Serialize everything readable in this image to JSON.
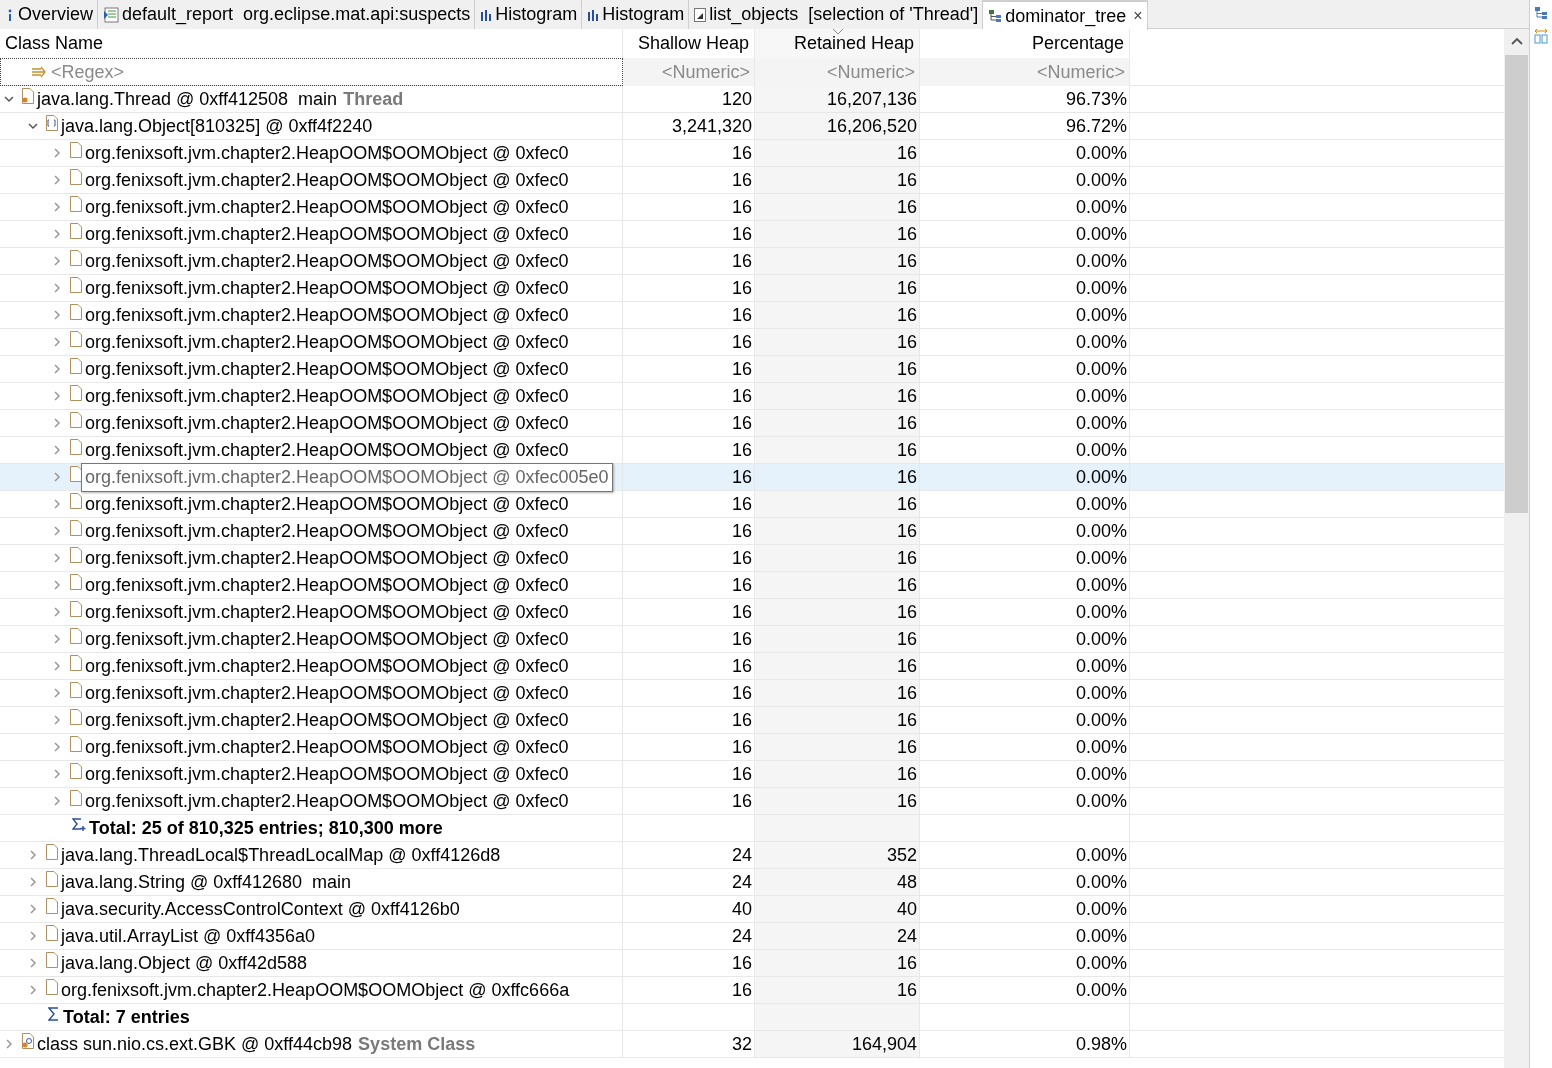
{
  "tabs": [
    {
      "label": "Overview",
      "kind": "info",
      "selected": false
    },
    {
      "label": "default_report  org.eclipse.mat.api:suspects",
      "kind": "report",
      "selected": false
    },
    {
      "label": "Histogram",
      "kind": "histogram",
      "selected": false
    },
    {
      "label": "Histogram",
      "kind": "histogram",
      "selected": false
    },
    {
      "label": "list_objects  [selection of 'Thread']",
      "kind": "list",
      "selected": false
    },
    {
      "label": "dominator_tree",
      "kind": "tree",
      "selected": true,
      "close": "×"
    }
  ],
  "table": {
    "columns": [
      {
        "label": "Class Name",
        "sorted": false
      },
      {
        "label": "Shallow Heap",
        "sorted": false
      },
      {
        "label": "Retained Heap",
        "sorted": true
      },
      {
        "label": "Percentage",
        "sorted": false
      }
    ],
    "filters": [
      "<Regex>",
      "<Numeric>",
      "<Numeric>",
      "<Numeric>"
    ],
    "rows": [
      {
        "kind": "thread",
        "name": "java.lang.Thread @ 0xff412508  main",
        "tag": "Thread",
        "shallow": "120",
        "retained": "16,207,136",
        "percentage": "96.73%",
        "expanded": true,
        "selected": false,
        "children": [
          {
            "kind": "array",
            "name": "java.lang.Object[810325] @ 0xff4f2240",
            "shallow": "3,241,320",
            "retained": "16,206,520",
            "percentage": "96.72%",
            "expanded": true,
            "selected": false,
            "children": [
              {
                "kind": "object",
                "name": "org.fenixsoft.jvm.chapter2.HeapOOM$OOMObject @ 0xfec0",
                "shallow": "16",
                "retained": "16",
                "percentage": "0.00%",
                "expanded": false,
                "selected": false
              },
              {
                "kind": "object",
                "name": "org.fenixsoft.jvm.chapter2.HeapOOM$OOMObject @ 0xfec0",
                "shallow": "16",
                "retained": "16",
                "percentage": "0.00%",
                "expanded": false,
                "selected": false
              },
              {
                "kind": "object",
                "name": "org.fenixsoft.jvm.chapter2.HeapOOM$OOMObject @ 0xfec0",
                "shallow": "16",
                "retained": "16",
                "percentage": "0.00%",
                "expanded": false,
                "selected": false
              },
              {
                "kind": "object",
                "name": "org.fenixsoft.jvm.chapter2.HeapOOM$OOMObject @ 0xfec0",
                "shallow": "16",
                "retained": "16",
                "percentage": "0.00%",
                "expanded": false,
                "selected": false
              },
              {
                "kind": "object",
                "name": "org.fenixsoft.jvm.chapter2.HeapOOM$OOMObject @ 0xfec0",
                "shallow": "16",
                "retained": "16",
                "percentage": "0.00%",
                "expanded": false,
                "selected": false
              },
              {
                "kind": "object",
                "name": "org.fenixsoft.jvm.chapter2.HeapOOM$OOMObject @ 0xfec0",
                "shallow": "16",
                "retained": "16",
                "percentage": "0.00%",
                "expanded": false,
                "selected": false
              },
              {
                "kind": "object",
                "name": "org.fenixsoft.jvm.chapter2.HeapOOM$OOMObject @ 0xfec0",
                "shallow": "16",
                "retained": "16",
                "percentage": "0.00%",
                "expanded": false,
                "selected": false
              },
              {
                "kind": "object",
                "name": "org.fenixsoft.jvm.chapter2.HeapOOM$OOMObject @ 0xfec0",
                "shallow": "16",
                "retained": "16",
                "percentage": "0.00%",
                "expanded": false,
                "selected": false
              },
              {
                "kind": "object",
                "name": "org.fenixsoft.jvm.chapter2.HeapOOM$OOMObject @ 0xfec0",
                "shallow": "16",
                "retained": "16",
                "percentage": "0.00%",
                "expanded": false,
                "selected": false
              },
              {
                "kind": "object",
                "name": "org.fenixsoft.jvm.chapter2.HeapOOM$OOMObject @ 0xfec0",
                "shallow": "16",
                "retained": "16",
                "percentage": "0.00%",
                "expanded": false,
                "selected": false
              },
              {
                "kind": "object",
                "name": "org.fenixsoft.jvm.chapter2.HeapOOM$OOMObject @ 0xfec0",
                "shallow": "16",
                "retained": "16",
                "percentage": "0.00%",
                "expanded": false,
                "selected": false
              },
              {
                "kind": "object",
                "name": "org.fenixsoft.jvm.chapter2.HeapOOM$OOMObject @ 0xfec0",
                "shallow": "16",
                "retained": "16",
                "percentage": "0.00%",
                "expanded": false,
                "selected": false
              },
              {
                "kind": "object",
                "name": "org.fenixsoft.jvm.chapter2.HeapOOM$OOMObject @ 0xfec005e0",
                "shallow": "16",
                "retained": "16",
                "percentage": "0.00%",
                "expanded": false,
                "selected": true
              },
              {
                "kind": "object",
                "name": "org.fenixsoft.jvm.chapter2.HeapOOM$OOMObject @ 0xfec0",
                "shallow": "16",
                "retained": "16",
                "percentage": "0.00%",
                "expanded": false,
                "selected": false
              },
              {
                "kind": "object",
                "name": "org.fenixsoft.jvm.chapter2.HeapOOM$OOMObject @ 0xfec0",
                "shallow": "16",
                "retained": "16",
                "percentage": "0.00%",
                "expanded": false,
                "selected": false
              },
              {
                "kind": "object",
                "name": "org.fenixsoft.jvm.chapter2.HeapOOM$OOMObject @ 0xfec0",
                "shallow": "16",
                "retained": "16",
                "percentage": "0.00%",
                "expanded": false,
                "selected": false
              },
              {
                "kind": "object",
                "name": "org.fenixsoft.jvm.chapter2.HeapOOM$OOMObject @ 0xfec0",
                "shallow": "16",
                "retained": "16",
                "percentage": "0.00%",
                "expanded": false,
                "selected": false
              },
              {
                "kind": "object",
                "name": "org.fenixsoft.jvm.chapter2.HeapOOM$OOMObject @ 0xfec0",
                "shallow": "16",
                "retained": "16",
                "percentage": "0.00%",
                "expanded": false,
                "selected": false
              },
              {
                "kind": "object",
                "name": "org.fenixsoft.jvm.chapter2.HeapOOM$OOMObject @ 0xfec0",
                "shallow": "16",
                "retained": "16",
                "percentage": "0.00%",
                "expanded": false,
                "selected": false
              },
              {
                "kind": "object",
                "name": "org.fenixsoft.jvm.chapter2.HeapOOM$OOMObject @ 0xfec0",
                "shallow": "16",
                "retained": "16",
                "percentage": "0.00%",
                "expanded": false,
                "selected": false
              },
              {
                "kind": "object",
                "name": "org.fenixsoft.jvm.chapter2.HeapOOM$OOMObject @ 0xfec0",
                "shallow": "16",
                "retained": "16",
                "percentage": "0.00%",
                "expanded": false,
                "selected": false
              },
              {
                "kind": "object",
                "name": "org.fenixsoft.jvm.chapter2.HeapOOM$OOMObject @ 0xfec0",
                "shallow": "16",
                "retained": "16",
                "percentage": "0.00%",
                "expanded": false,
                "selected": false
              },
              {
                "kind": "object",
                "name": "org.fenixsoft.jvm.chapter2.HeapOOM$OOMObject @ 0xfec0",
                "shallow": "16",
                "retained": "16",
                "percentage": "0.00%",
                "expanded": false,
                "selected": false
              },
              {
                "kind": "object",
                "name": "org.fenixsoft.jvm.chapter2.HeapOOM$OOMObject @ 0xfec0",
                "shallow": "16",
                "retained": "16",
                "percentage": "0.00%",
                "expanded": false,
                "selected": false
              },
              {
                "kind": "object",
                "name": "org.fenixsoft.jvm.chapter2.HeapOOM$OOMObject @ 0xfec0",
                "shallow": "16",
                "retained": "16",
                "percentage": "0.00%",
                "expanded": false,
                "selected": false
              },
              {
                "kind": "total_more",
                "name": "Total: 25 of 810,325 entries; 810,300 more"
              }
            ]
          },
          {
            "kind": "object",
            "name": "java.lang.ThreadLocal$ThreadLocalMap @ 0xff4126d8",
            "shallow": "24",
            "retained": "352",
            "percentage": "0.00%",
            "expanded": false,
            "selected": false
          },
          {
            "kind": "object",
            "name": "java.lang.String @ 0xff412680  main",
            "shallow": "24",
            "retained": "48",
            "percentage": "0.00%",
            "expanded": false,
            "selected": false
          },
          {
            "kind": "object",
            "name": "java.security.AccessControlContext @ 0xff4126b0",
            "shallow": "40",
            "retained": "40",
            "percentage": "0.00%",
            "expanded": false,
            "selected": false
          },
          {
            "kind": "object",
            "name": "java.util.ArrayList @ 0xff4356a0",
            "shallow": "24",
            "retained": "24",
            "percentage": "0.00%",
            "expanded": false,
            "selected": false
          },
          {
            "kind": "object",
            "name": "java.lang.Object @ 0xff42d588",
            "shallow": "16",
            "retained": "16",
            "percentage": "0.00%",
            "expanded": false,
            "selected": false
          },
          {
            "kind": "object",
            "name": "org.fenixsoft.jvm.chapter2.HeapOOM$OOMObject @ 0xffc666a",
            "shallow": "16",
            "retained": "16",
            "percentage": "0.00%",
            "expanded": false,
            "selected": false
          },
          {
            "kind": "total",
            "name": "Total: 7 entries"
          }
        ]
      },
      {
        "kind": "class",
        "name": "class sun.nio.cs.ext.GBK @ 0xff44cb98",
        "tag": "System Class",
        "shallow": "32",
        "retained": "164,904",
        "percentage": "0.98%",
        "expanded": false,
        "selected": false
      }
    ]
  }
}
